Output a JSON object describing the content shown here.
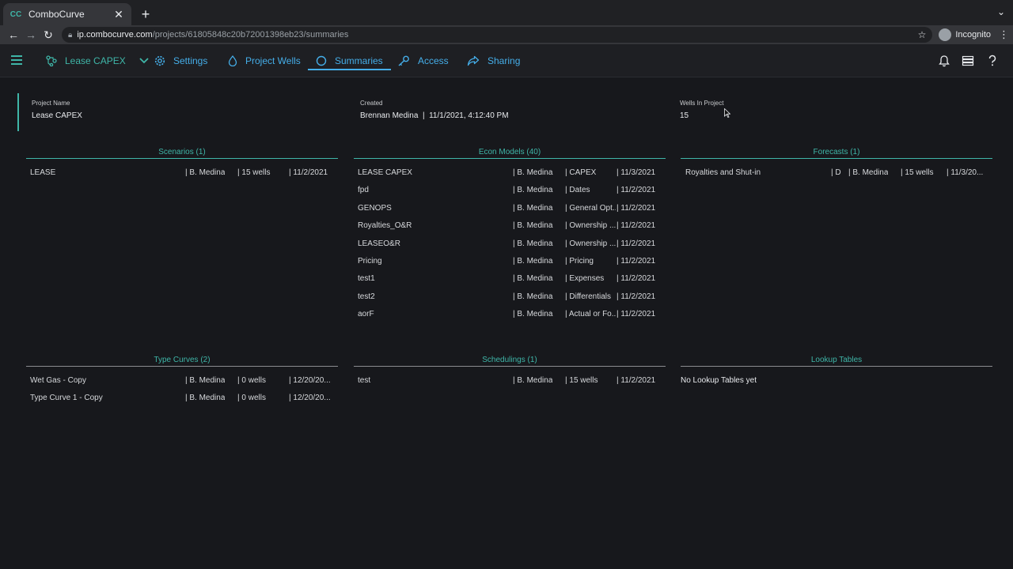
{
  "browser": {
    "tab_title": "ComboCurve",
    "url_host": "ip.combocurve.com",
    "url_path": "/projects/61805848c20b72001398eb23/summaries",
    "incognito_label": "Incognito"
  },
  "nav": {
    "project_label": "Lease CAPEX",
    "items": [
      {
        "label": "Settings"
      },
      {
        "label": "Project Wells"
      },
      {
        "label": "Summaries"
      },
      {
        "label": "Access"
      },
      {
        "label": "Sharing"
      }
    ],
    "accent_color": "#45aee9",
    "brand_color": "#3fb6a8"
  },
  "project": {
    "name_label": "Project Name",
    "name": "Lease CAPEX",
    "created_label": "Created",
    "created_by": "Brennan Medina",
    "created_at": "11/1/2021, 4:12:40 PM",
    "wells_label": "Wells In Project",
    "wells": "15"
  },
  "scenarios": {
    "title": "Scenarios (1)",
    "rows": [
      [
        "LEASE",
        "| B. Medina",
        "| 15 wells",
        "| 11/2/2021"
      ]
    ]
  },
  "econ_models": {
    "title": "Econ Models (40)",
    "rows": [
      [
        "LEASE CAPEX",
        "| B. Medina",
        "| CAPEX",
        "| 11/3/2021"
      ],
      [
        "fpd",
        "| B. Medina",
        "| Dates",
        "| 11/2/2021"
      ],
      [
        "GENOPS",
        "| B. Medina",
        "| General Opt...",
        "| 11/2/2021"
      ],
      [
        "Royalties_O&R",
        "| B. Medina",
        "| Ownership ...",
        "| 11/2/2021"
      ],
      [
        "LEASEO&R",
        "| B. Medina",
        "| Ownership ...",
        "| 11/2/2021"
      ],
      [
        "Pricing",
        "| B. Medina",
        "| Pricing",
        "| 11/2/2021"
      ],
      [
        "test1",
        "| B. Medina",
        "| Expenses",
        "| 11/2/2021"
      ],
      [
        "test2",
        "| B. Medina",
        "| Differentials",
        "| 11/2/2021"
      ],
      [
        "aorF",
        "| B. Medina",
        "| Actual or Fo...",
        "| 11/2/2021"
      ]
    ]
  },
  "forecasts": {
    "title": "Forecasts (1)",
    "rows": [
      [
        "Royalties and Shut-in",
        "| D",
        "| B. Medina",
        "| 15 wells",
        "| 11/3/20..."
      ]
    ]
  },
  "type_curves": {
    "title": "Type Curves (2)",
    "rows": [
      [
        "Wet Gas - Copy",
        "| B. Medina",
        "| 0 wells",
        "| 12/20/20..."
      ],
      [
        "Type Curve 1 - Copy",
        "| B. Medina",
        "| 0 wells",
        "| 12/20/20..."
      ]
    ]
  },
  "schedulings": {
    "title": "Schedulings (1)",
    "rows": [
      [
        "test",
        "| B. Medina",
        "| 15 wells",
        "| 11/2/2021"
      ]
    ]
  },
  "lookup_tables": {
    "title": "Lookup Tables",
    "empty_text": "No Lookup Tables yet"
  }
}
